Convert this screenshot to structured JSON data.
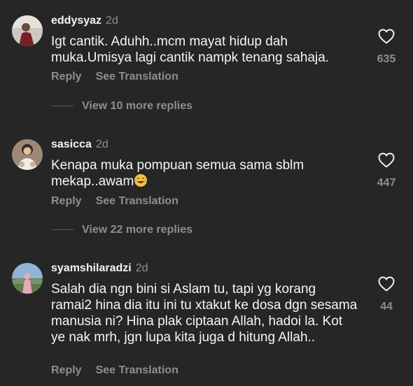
{
  "comments": [
    {
      "username": "eddysyaz",
      "time": "2d",
      "text": "Igt cantik. Aduhh..mcm mayat hidup dah muka.Umisya lagi cantik nampk tenang sahaja.",
      "reply_label": "Reply",
      "translate_label": "See Translation",
      "likes": "635",
      "view_more": "View 10 more replies"
    },
    {
      "username": "sasicca",
      "time": "2d",
      "text": "Kenapa muka pompuan semua sama sblm mekap..awam",
      "emoji": "laughing-tears-emoji",
      "reply_label": "Reply",
      "translate_label": "See Translation",
      "likes": "447",
      "view_more": "View 22 more replies"
    },
    {
      "username": "syamshilaradzi",
      "time": "2d",
      "text": "Salah dia ngn bini si Aslam tu, tapi yg korang ramai2 hina dia itu ini tu xtakut ke dosa dgn sesama manusia ni?  Hina plak ciptaan Allah, hadoi la. Kot ye nak mrh, jgn lupa kita juga d hitung Allah..",
      "reply_label": "Reply",
      "translate_label": "See Translation",
      "likes": "44"
    }
  ],
  "colors": {
    "background": "#262626",
    "text": "#f5f5f5",
    "muted": "#8e8e8e"
  },
  "icons": {
    "like": "heart-outline-icon"
  }
}
